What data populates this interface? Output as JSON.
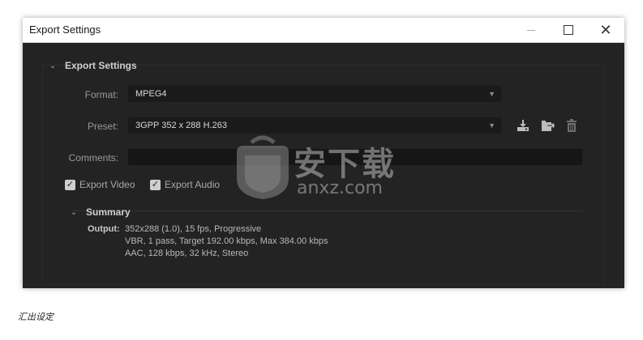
{
  "window": {
    "title": "Export Settings"
  },
  "export_settings": {
    "section_label": "Export Settings",
    "format_label": "Format:",
    "format_value": "MPEG4",
    "preset_label": "Preset:",
    "preset_value": "3GPP 352 x 288 H.263",
    "comments_label": "Comments:",
    "comments_value": "",
    "export_video_label": "Export Video",
    "export_video_checked": true,
    "export_audio_label": "Export Audio",
    "export_audio_checked": true
  },
  "summary": {
    "section_label": "Summary",
    "output_label": "Output:",
    "lines": [
      "352x288 (1.0), 15 fps, Progressive",
      "VBR, 1 pass, Target 192.00 kbps, Max 384.00 kbps",
      "AAC, 128 kbps, 32 kHz, Stereo"
    ]
  },
  "watermark": {
    "text": "安下载",
    "subtext": "anxz.com"
  },
  "caption": "汇出设定",
  "icons": {
    "minimize": "minimize-icon",
    "maximize": "maximize-icon",
    "close": "close-icon",
    "save_preset": "save-preset-icon",
    "import_preset": "import-preset-icon",
    "delete_preset": "delete-preset-icon",
    "chevron": "chevron-down-icon"
  },
  "colors": {
    "window_bg": "#232323",
    "field_bg": "#1a1a1a",
    "titlebar_bg": "#ffffff"
  }
}
